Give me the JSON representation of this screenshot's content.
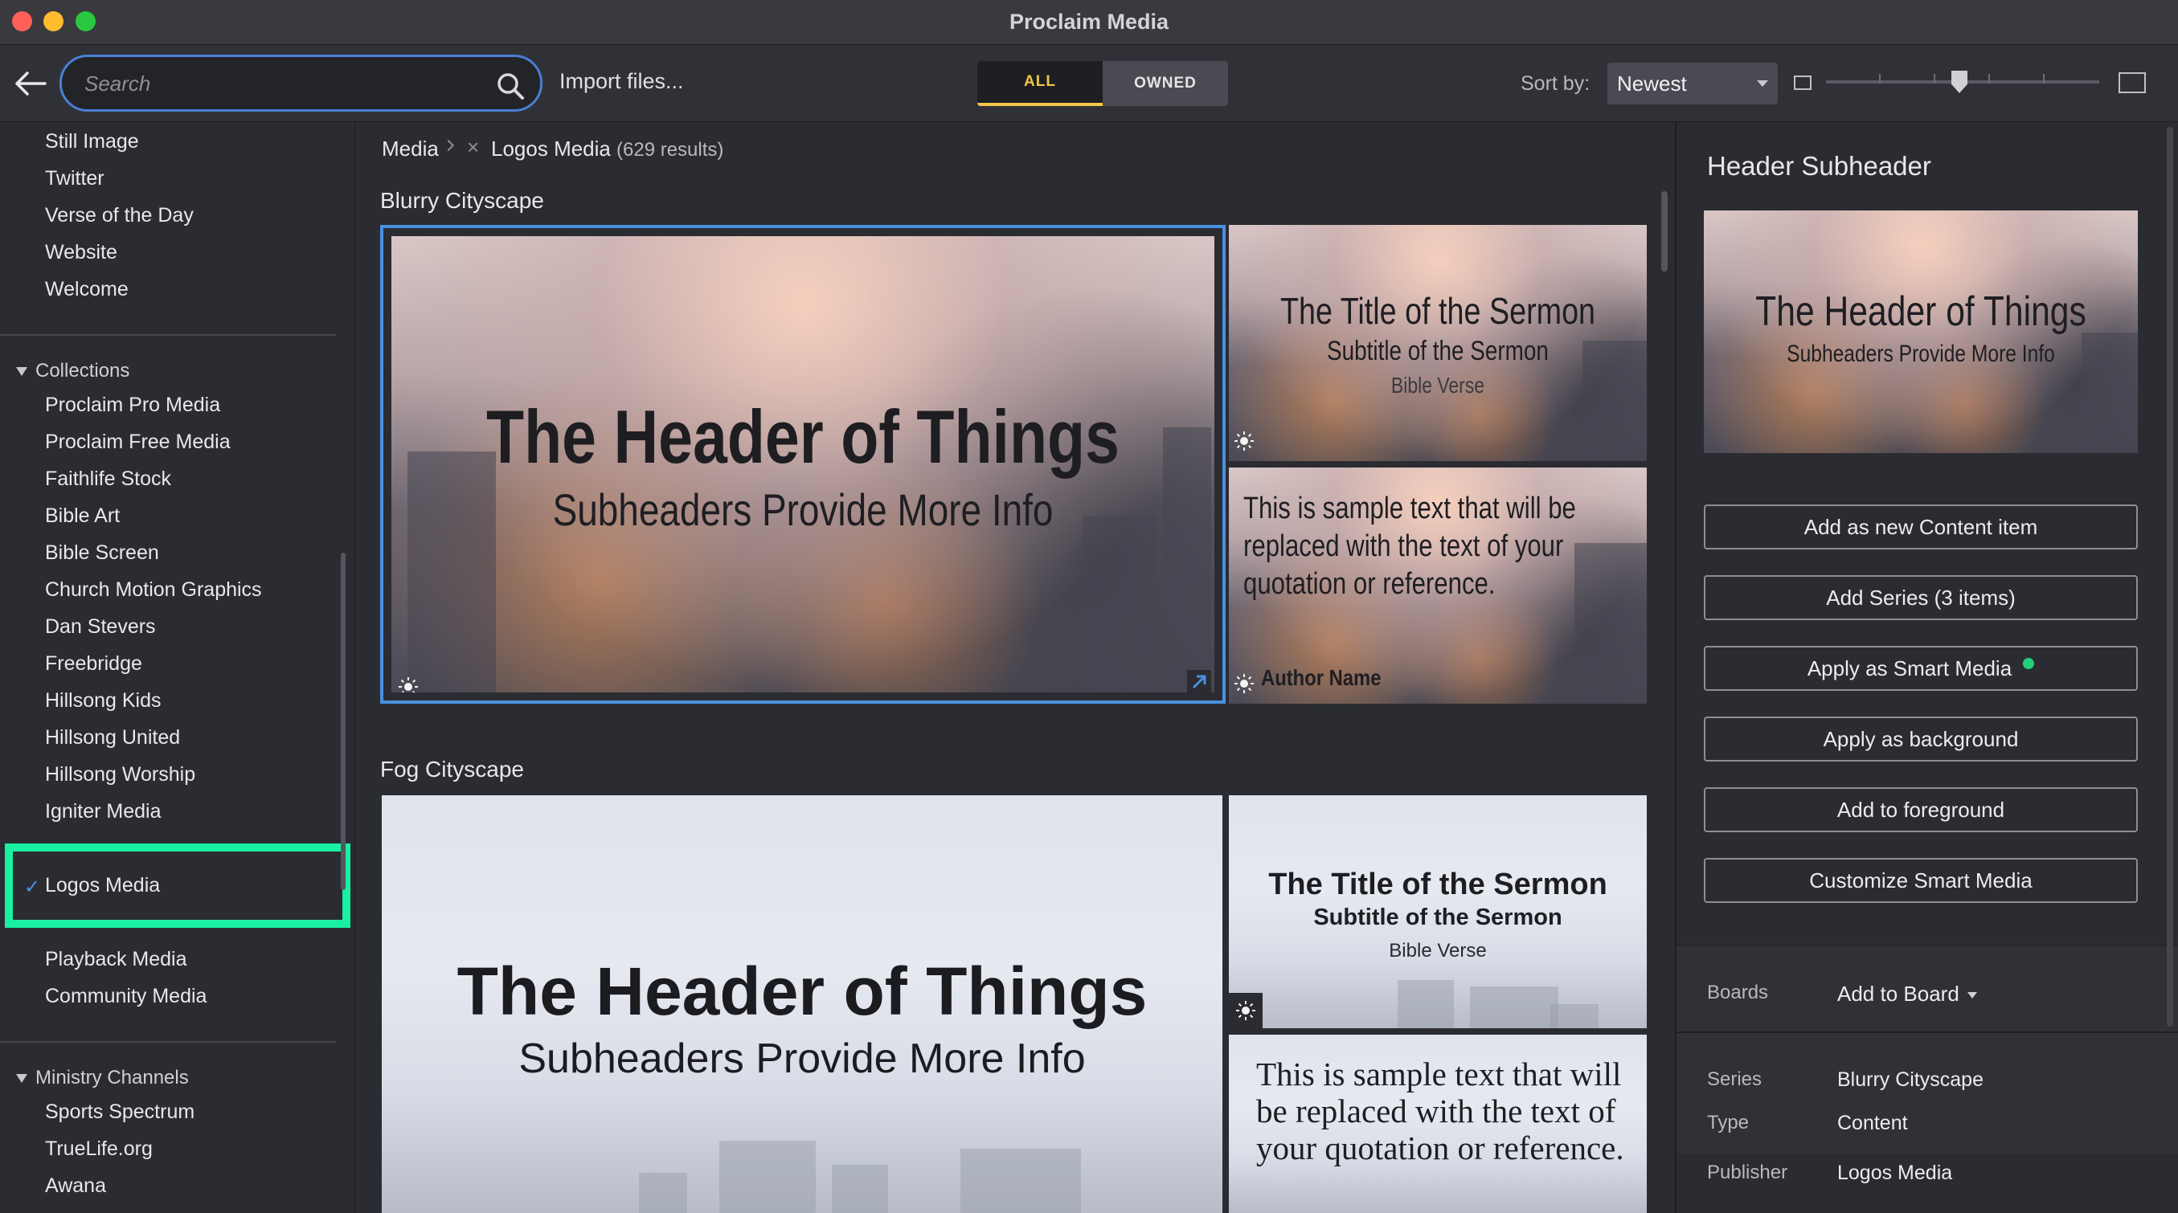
{
  "window": {
    "title": "Proclaim Media"
  },
  "toolbar": {
    "search_placeholder": "Search",
    "import_label": "Import files...",
    "filter_all": "ALL",
    "filter_owned": "OWNED",
    "sort_label": "Sort by:",
    "sort_value": "Newest",
    "thumbnail_size_level": 0.5
  },
  "sidebar": {
    "top_items": [
      "Still Image",
      "Twitter",
      "Verse of the Day",
      "Website",
      "Welcome"
    ],
    "collections_header": "Collections",
    "collections": [
      "Proclaim Pro Media",
      "Proclaim Free Media",
      "Faithlife Stock",
      "Bible Art",
      "Bible Screen",
      "Church Motion Graphics",
      "Dan Stevers",
      "Freebridge",
      "Hillsong Kids",
      "Hillsong United",
      "Hillsong Worship",
      "Igniter Media"
    ],
    "selected_collection": "Logos Media",
    "collections_after": [
      "Playback Media",
      "Community Media"
    ],
    "ministry_header": "Ministry Channels",
    "ministry": [
      "Sports Spectrum",
      "TrueLife.org",
      "Awana"
    ]
  },
  "main": {
    "breadcrumb_root": "Media",
    "breadcrumb_filter": "Logos Media",
    "result_count": "(629 results)",
    "series": [
      {
        "title": "Blurry Cityscape",
        "large": {
          "header": "The Header of Things",
          "subheader": "Subheaders Provide More Info"
        },
        "sermon": {
          "title": "The Title of the Sermon",
          "subtitle": "Subtitle of the Sermon",
          "verse": "Bible Verse"
        },
        "quote": {
          "text": "This is sample text that will be replaced with the text of your quotation or reference.",
          "author": "Author Name"
        }
      },
      {
        "title": "Fog Cityscape",
        "large": {
          "header": "The Header of Things",
          "subheader": "Subheaders Provide More Info"
        },
        "sermon": {
          "title": "The Title of the Sermon",
          "subtitle": "Subtitle of the Sermon",
          "verse": "Bible Verse"
        },
        "quote": {
          "text": "This is sample text that will be replaced with the text of your quotation or reference."
        }
      }
    ]
  },
  "panel": {
    "title": "Header Subheader",
    "preview": {
      "header": "The Header of Things",
      "subheader": "Subheaders Provide More Info"
    },
    "buttons": [
      "Add as new Content item",
      "Add Series (3 items)",
      "Apply as Smart Media",
      "Apply as background",
      "Add to foreground",
      "Customize Smart Media"
    ],
    "boards_label": "Boards",
    "boards_action": "Add to Board",
    "meta": [
      {
        "key": "Series",
        "value": "Blurry Cityscape"
      },
      {
        "key": "Type",
        "value": "Content"
      },
      {
        "key": "Publisher",
        "value": "Logos Media"
      }
    ]
  },
  "colors": {
    "accent_blue": "#4a90e2",
    "highlight_green": "#19f0a2",
    "filter_active": "#f2c74a",
    "status_green": "#22d07a"
  },
  "icons": [
    "back-arrow-icon",
    "search-icon",
    "sun-icon",
    "expand-icon",
    "check-icon",
    "caret-down-icon",
    "small-thumbnail-icon",
    "large-thumbnail-icon"
  ]
}
